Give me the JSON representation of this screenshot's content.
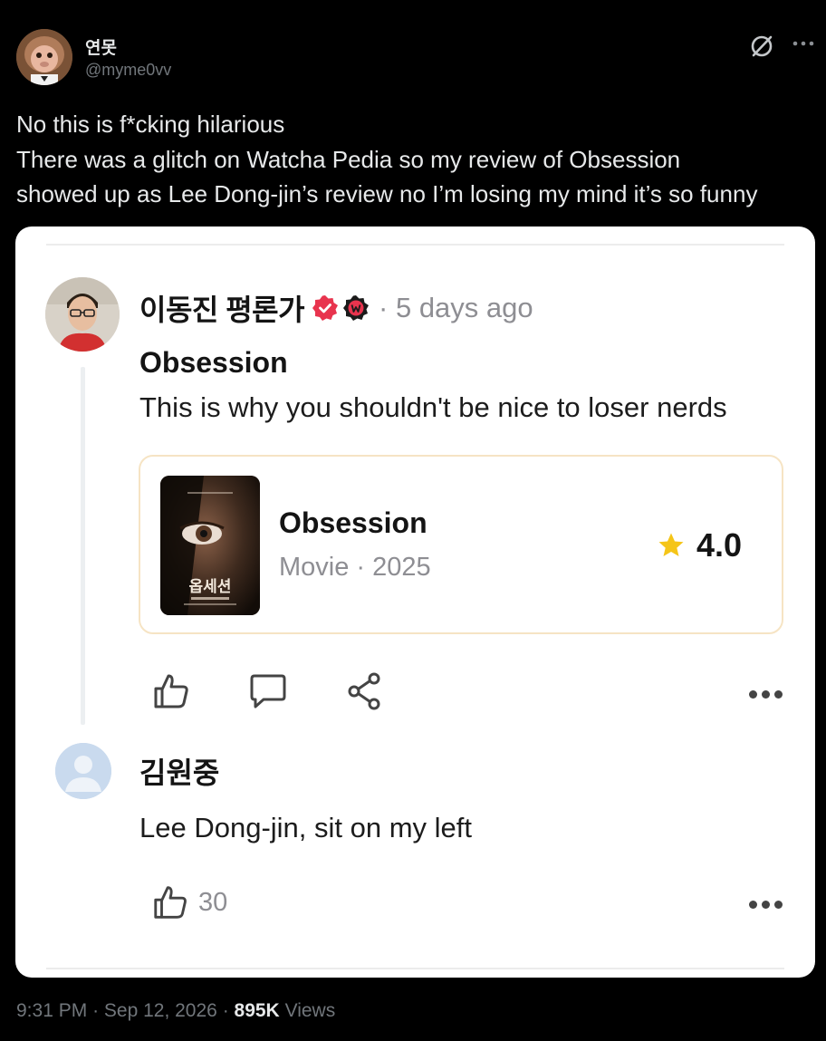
{
  "author": {
    "name": "연못",
    "handle": "@myme0vv"
  },
  "tweet": {
    "lines": [
      "No this is f*cking hilarious",
      "There was a glitch on Watcha Pedia so my review of Obsession",
      "showed up as Lee Dong-jin’s review no I’m losing my mind it’s so funny"
    ]
  },
  "review": {
    "reviewer_name": "이동진 평론가",
    "time_ago": "· 5 days ago",
    "title": "Obsession",
    "body": "This is why you shouldn't be nice to loser nerds",
    "movie": {
      "title": "Obsession",
      "meta": "Movie · 2025",
      "rating": "4.0",
      "poster_title": "옵세션"
    }
  },
  "comment": {
    "name": "김원중",
    "text": "Lee Dong-jin, sit on my left",
    "likes": "30"
  },
  "footer": {
    "time": "9:31 PM",
    "date": "Sep 12, 2026",
    "views_count": "895K",
    "views_label": "Views"
  },
  "colors": {
    "background": "#000000",
    "card": "#ffffff",
    "verified_badge": "#e8344e",
    "star": "#f5c518",
    "muted": "#71767b"
  },
  "icons": [
    "grok-icon",
    "more-icon",
    "verified-icon",
    "watcha-w-icon",
    "star-icon",
    "like-icon",
    "comment-icon",
    "share-icon",
    "more-dots-icon"
  ]
}
